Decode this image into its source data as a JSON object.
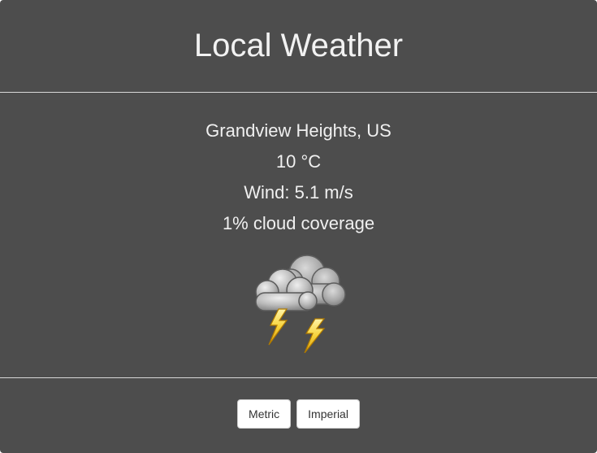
{
  "header": {
    "title": "Local Weather"
  },
  "weather": {
    "location": "Grandview Heights, US",
    "temperature": "10 °C",
    "wind": "Wind: 5.1 m/s",
    "clouds": "1% cloud coverage",
    "icon": "thunderstorm-icon"
  },
  "units": {
    "metric_label": "Metric",
    "imperial_label": "Imperial"
  },
  "colors": {
    "panel_background": "#4d4d4d",
    "text": "#f0f0f0",
    "divider": "#d8d8d8",
    "button_background": "#ffffff"
  }
}
